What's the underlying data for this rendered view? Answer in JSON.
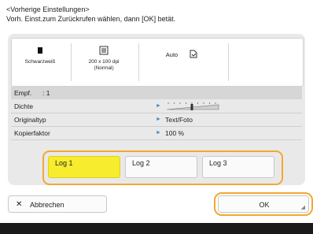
{
  "header": {
    "title": "<Vorherige Einstellungen>",
    "subtitle": "Vorh. Einst.zum Zurückrufen wählen, dann [OK] betät."
  },
  "summary": {
    "color_mode": "Schwarzweiß",
    "paper_size_line1": "200 x 100 dpi",
    "paper_size_line2": "(Normal)",
    "auto_label": "Auto",
    "icons": [
      "black-white-icon",
      "paper-size-icon",
      "document-icon"
    ]
  },
  "details": {
    "recipient_label": "Empf.",
    "recipient_value": ": 1",
    "density_label": "Dichte",
    "original_type_label": "Originaltyp",
    "original_type_value": "Text/Foto",
    "copy_factor_label": "Kopierfaktor",
    "copy_factor_value": "100 %",
    "density_level": 0.5
  },
  "logs": {
    "items": [
      "Log 1",
      "Log 2",
      "Log 3"
    ],
    "selected_index": 0
  },
  "footer": {
    "cancel_label": "Abbrechen",
    "ok_label": "OK"
  },
  "colors": {
    "accent": "#f2a830",
    "selected": "#f7ec2d",
    "arrow": "#3a8bd0"
  }
}
